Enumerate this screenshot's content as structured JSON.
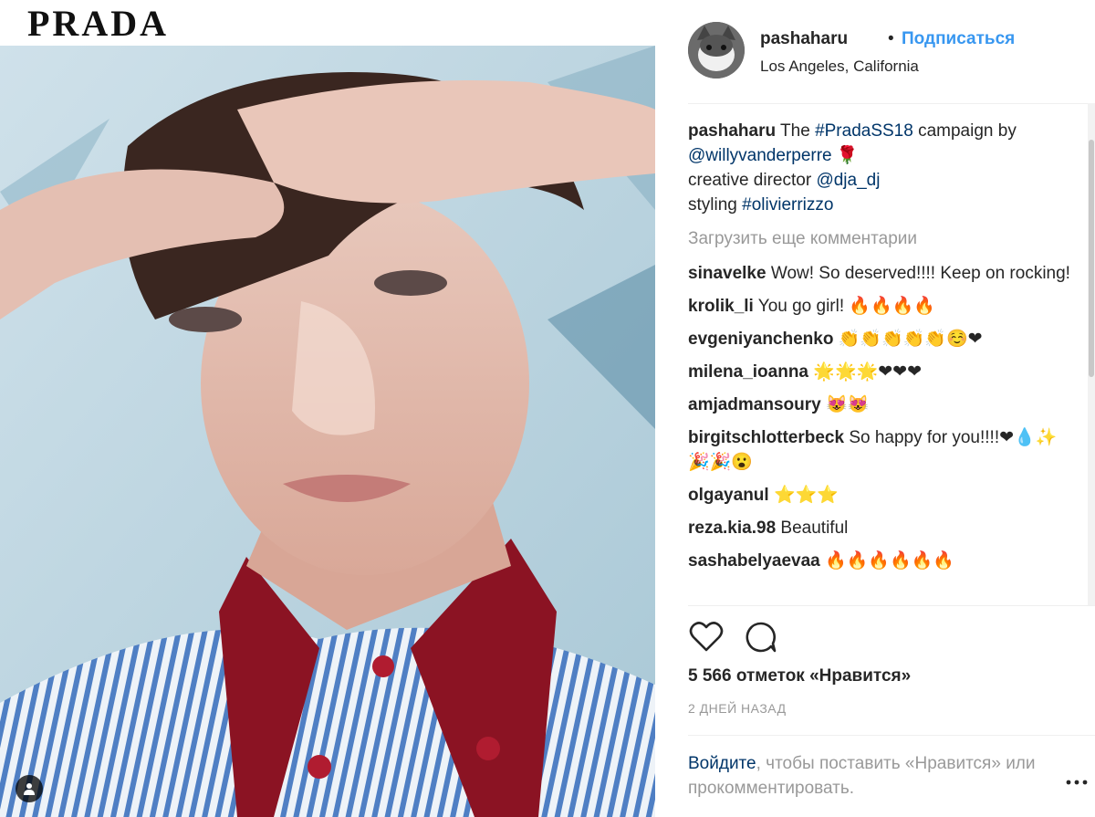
{
  "brand": {
    "logo_text": "PRADA"
  },
  "post": {
    "username": "pashaharu",
    "dot": "•",
    "follow_label": "Подписаться",
    "location": "Los Angeles, California",
    "caption": {
      "username": "pashaharu",
      "text_1": " The ",
      "hashtag_1": "#PradaSS18",
      "text_2": " campaign by",
      "mention_1": "@willyvanderperre",
      "rose": " 🌹",
      "text_3": "creative director ",
      "mention_2": "@dja_dj",
      "text_4": "styling ",
      "hashtag_2": "#olivierrizzo"
    },
    "load_more_label": "Загрузить еще комментарии",
    "comments": [
      {
        "user": "sinavelke",
        "text": "Wow! So deserved!!!! Keep on rocking!"
      },
      {
        "user": "krolik_li",
        "text": "You go girl! 🔥🔥🔥🔥"
      },
      {
        "user": "evgeniyanchenko",
        "text": "👏👏👏👏👏☺️❤"
      },
      {
        "user": "milena_ioanna",
        "text": "🌟🌟🌟❤❤❤"
      },
      {
        "user": "amjadmansoury",
        "text": "😻😻"
      },
      {
        "user": "birgitschlotterbeck",
        "text": "So happy for you!!!!❤💧✨🎉🎉😮"
      },
      {
        "user": "olgayanul",
        "text": "⭐⭐⭐"
      },
      {
        "user": "reza.kia.98",
        "text": "Beautiful"
      },
      {
        "user": "sashabelyaevaa",
        "text": "🔥🔥🔥🔥🔥🔥"
      }
    ],
    "likes_label": "5 566 отметок «Нравится»",
    "time_label": "2 ДНЕЙ НАЗАД",
    "login_link": "Войдите",
    "login_text": ", чтобы поставить «Нравится» или прокомментировать.",
    "icons": {
      "like": "heart-icon",
      "comment": "comment-icon",
      "more": "more-options-icon",
      "user_tag": "user-tag-icon"
    }
  }
}
